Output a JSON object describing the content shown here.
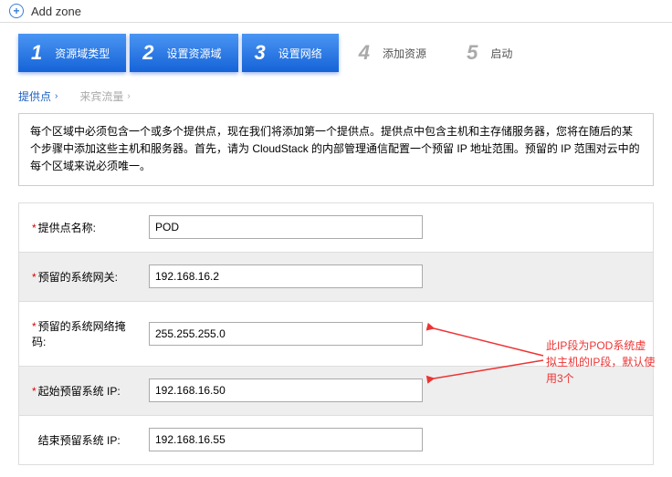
{
  "header": {
    "icon": "+",
    "title": "Add zone"
  },
  "steps": [
    {
      "num": "1",
      "label": "资源域类型",
      "active": true
    },
    {
      "num": "2",
      "label": "设置资源域",
      "active": true
    },
    {
      "num": "3",
      "label": "设置网络",
      "active": true
    },
    {
      "num": "4",
      "label": "添加资源",
      "active": false
    },
    {
      "num": "5",
      "label": "启动",
      "active": false
    }
  ],
  "tabs": {
    "pod": "提供点",
    "guest": "来宾流量"
  },
  "info": "每个区域中必须包含一个或多个提供点，现在我们将添加第一个提供点。提供点中包含主机和主存储服务器，您将在随后的某个步骤中添加这些主机和服务器。首先，请为 CloudStack 的内部管理通信配置一个预留 IP 地址范围。预留的 IP 范围对云中的每个区域来说必须唯一。",
  "form": {
    "name_label": "提供点名称:",
    "name_value": "POD",
    "gw_label": "预留的系统网关:",
    "gw_value": "192.168.16.2",
    "mask_label": "预留的系统网络掩码:",
    "mask_value": "255.255.255.0",
    "start_label": "起始预留系统 IP:",
    "start_value": "192.168.16.50",
    "end_label": "结束预留系统 IP:",
    "end_value": "192.168.16.55"
  },
  "annotation": "此IP段为POD系统虚拟主机的IP段，默认使用3个"
}
